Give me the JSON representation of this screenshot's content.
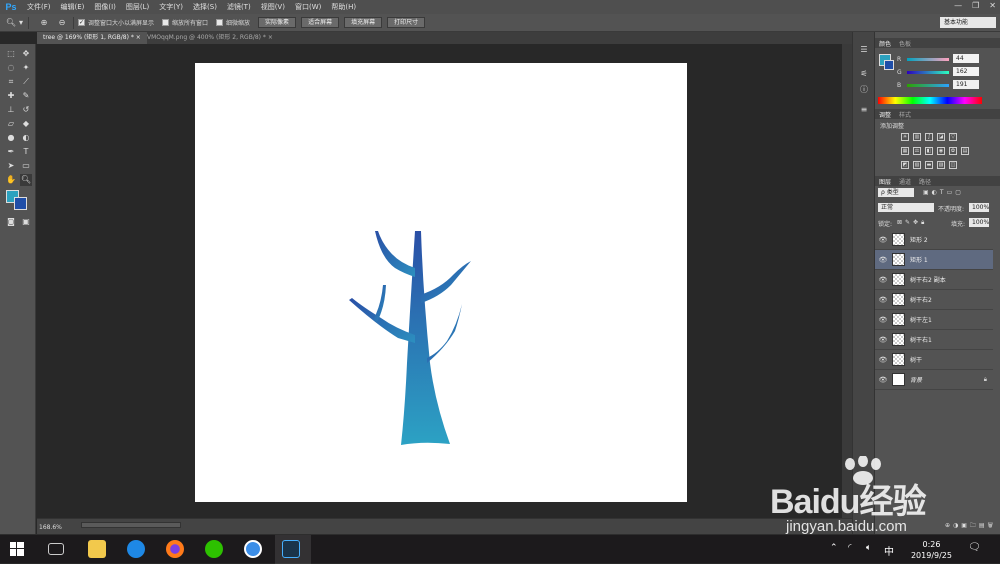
{
  "app": {
    "logo": "Ps"
  },
  "menu": [
    "文件(F)",
    "编辑(E)",
    "图像(I)",
    "图层(L)",
    "文字(Y)",
    "选择(S)",
    "滤镜(T)",
    "视图(V)",
    "窗口(W)",
    "帮助(H)"
  ],
  "options": {
    "chk_resize_window": "调整窗口大小以满屏显示",
    "chk_zoom_all": "缩放所有窗口",
    "chk_scrubby": "细微缩放",
    "btn_actual": "实际像素",
    "btn_fit": "适合屏幕",
    "btn_fill": "填充屏幕",
    "btn_print": "打印尺寸",
    "workspace": "基本功能"
  },
  "tabs": [
    {
      "label": "tree @ 169% (矩形 1, RGB/8) *"
    },
    {
      "label": "VMOqqM.png @ 400% (矩形 2, RGB/8) *"
    }
  ],
  "status": {
    "zoom": "168.6%"
  },
  "color_panel": {
    "tabs": [
      "颜色",
      "色板"
    ],
    "r_label": "R",
    "g_label": "G",
    "b_label": "B",
    "r": "44",
    "g": "162",
    "b": "191"
  },
  "adjust_panel": {
    "tabs": [
      "调整",
      "样式"
    ],
    "add_label": "添加调整"
  },
  "layers_panel": {
    "tabs": [
      "图层",
      "通道",
      "路径"
    ],
    "filter_kind": "ρ 类型",
    "blend_mode": "正常",
    "opacity_label": "不透明度:",
    "opacity": "100%",
    "lock_label": "锁定:",
    "fill_label": "填充:",
    "fill": "100%",
    "layers": [
      {
        "name": "矩形 2"
      },
      {
        "name": "矩形 1"
      },
      {
        "name": "树干右2 副本"
      },
      {
        "name": "树干右2"
      },
      {
        "name": "树干左1"
      },
      {
        "name": "树干右1"
      },
      {
        "name": "树干"
      },
      {
        "name": "背景"
      }
    ]
  },
  "taskbar": {
    "time": "0:26",
    "date": "2019/9/25",
    "ime": "中"
  },
  "watermark": {
    "brand": "Baidu经验",
    "url": "jingyan.baidu.com"
  },
  "colors": {
    "tree_top": "#2a4fa6",
    "tree_bottom": "#2ca2c4",
    "selection": "#5f6a80"
  }
}
